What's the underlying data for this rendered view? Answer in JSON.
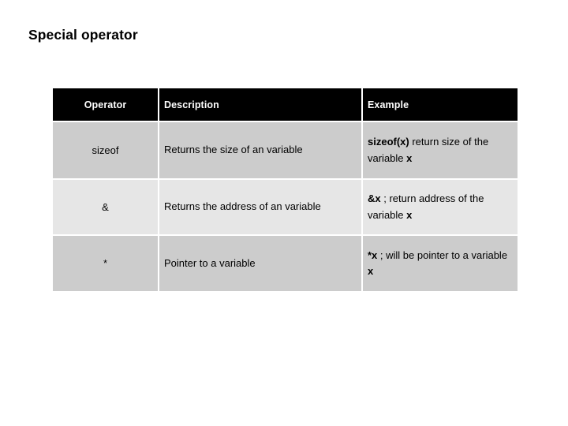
{
  "slide": {
    "title": "Special operator",
    "background_color": "#ffffff"
  },
  "table": {
    "header_background": "#000000",
    "header_text_color": "#ffffff",
    "row_shade_dark": "#cccccc",
    "row_shade_light": "#e6e6e6",
    "columns": [
      {
        "key": "operator",
        "label": "Operator"
      },
      {
        "key": "description",
        "label": "Description"
      },
      {
        "key": "example",
        "label": "Example"
      }
    ],
    "rows": [
      {
        "operator": "sizeof",
        "description": "Returns the size of an variable",
        "example_parts": [
          {
            "text": "sizeof(x)",
            "bold": true
          },
          {
            "text": " return size of the variable ",
            "bold": false
          },
          {
            "text": "x",
            "bold": true
          }
        ],
        "example_plain": "sizeof(x) return size of the variable x",
        "shade": "dark"
      },
      {
        "operator": "&",
        "description": "Returns the address of an variable",
        "example_parts": [
          {
            "text": "&x",
            "bold": true
          },
          {
            "text": " ; return address of the variable ",
            "bold": false
          },
          {
            "text": "x",
            "bold": true
          }
        ],
        "example_plain": "&x ; return address of the variable x",
        "shade": "light"
      },
      {
        "operator": "*",
        "description": "Pointer to a variable",
        "example_parts": [
          {
            "text": "*x",
            "bold": true
          },
          {
            "text": " ; will be pointer to a variable ",
            "bold": false
          },
          {
            "text": "x",
            "bold": true
          }
        ],
        "example_plain": "*x ; will be pointer to a variable x",
        "shade": "dark"
      }
    ]
  }
}
